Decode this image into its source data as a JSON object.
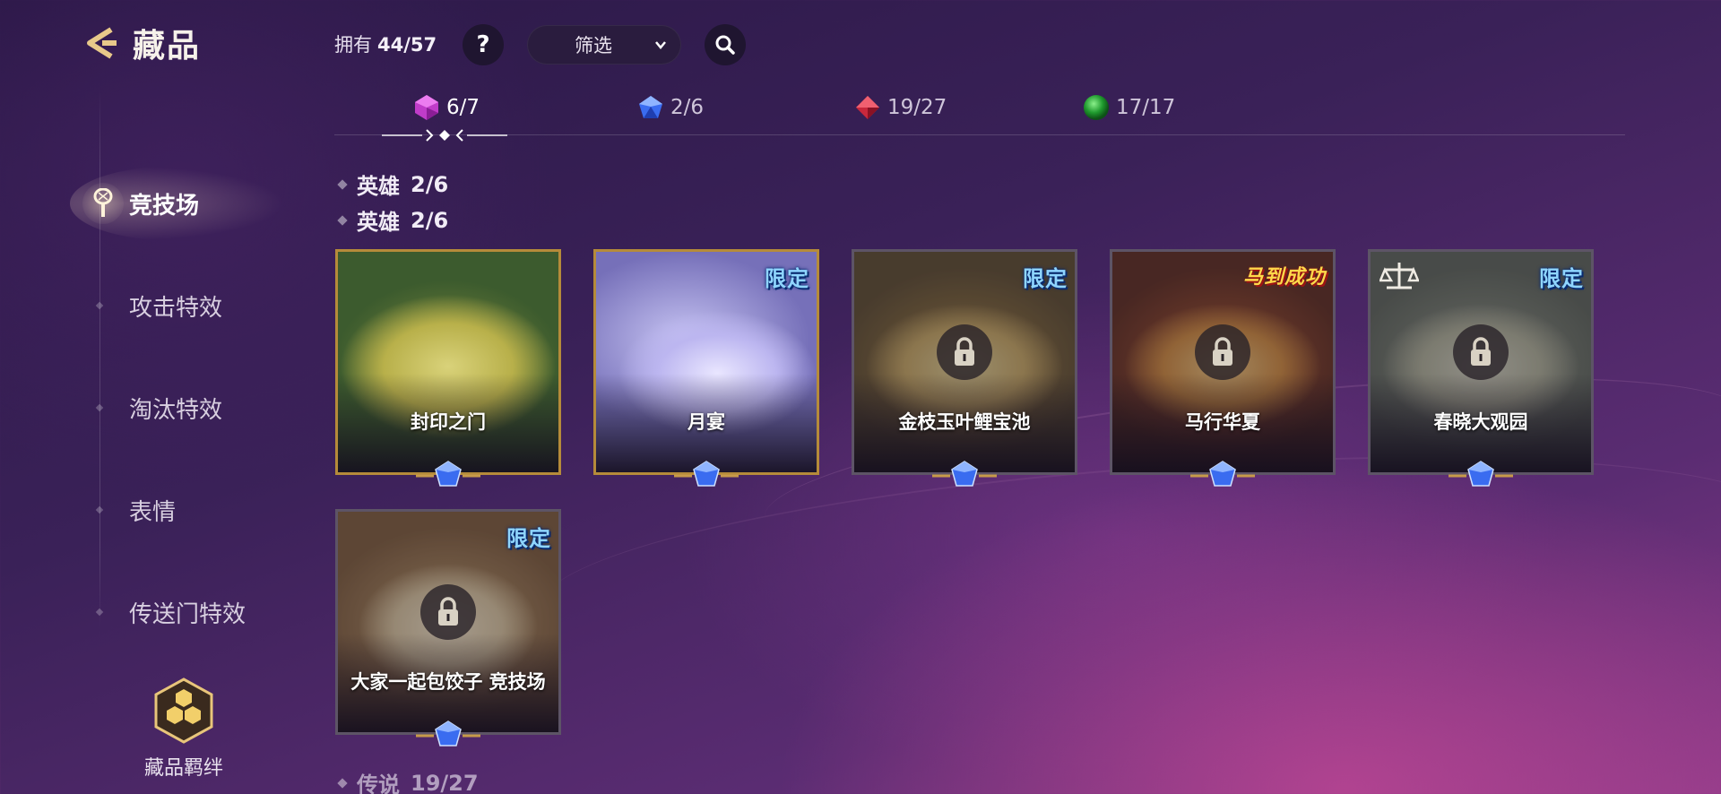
{
  "header": {
    "back_title": "藏品",
    "owned_label": "拥有",
    "owned_value": "44/57",
    "help_label": "?",
    "filter_label": "筛选"
  },
  "sidebar": {
    "items": [
      {
        "label": "竞技场",
        "active": true
      },
      {
        "label": "攻击特效",
        "active": false
      },
      {
        "label": "淘汰特效",
        "active": false
      },
      {
        "label": "表情",
        "active": false
      },
      {
        "label": "传送门特效",
        "active": false
      }
    ],
    "bond_label": "藏品羁绊"
  },
  "rarity_tabs": [
    {
      "icon": "purple-gem-icon",
      "count": "6/7",
      "color": "#c03cc9",
      "active": true
    },
    {
      "icon": "blue-gem-icon",
      "count": "2/6",
      "color": "#3a6cf0",
      "active": false
    },
    {
      "icon": "red-gem-icon",
      "count": "19/27",
      "color": "#c8283c",
      "active": false
    },
    {
      "icon": "green-orb-icon",
      "count": "17/17",
      "color": "#1f9a2e",
      "active": false
    }
  ],
  "sections": [
    {
      "title": "英雄",
      "count": "2/6"
    },
    {
      "title": "英雄",
      "count": "2/6"
    },
    {
      "title": "传说",
      "count": "19/27"
    }
  ],
  "cards": [
    {
      "name": "封印之门",
      "owned": true,
      "badge": "",
      "locked": false
    },
    {
      "name": "月宴",
      "owned": true,
      "badge": "限定",
      "locked": false
    },
    {
      "name": "金枝玉叶鲤宝池",
      "owned": false,
      "badge": "限定",
      "locked": true
    },
    {
      "name": "马行华夏",
      "owned": false,
      "badge": "马到成功",
      "locked": true
    },
    {
      "name": "春晓大观园",
      "owned": false,
      "badge": "限定",
      "locked": true
    },
    {
      "name": "大家一起包饺子 竞技场",
      "owned": false,
      "badge": "限定",
      "locked": true
    }
  ]
}
